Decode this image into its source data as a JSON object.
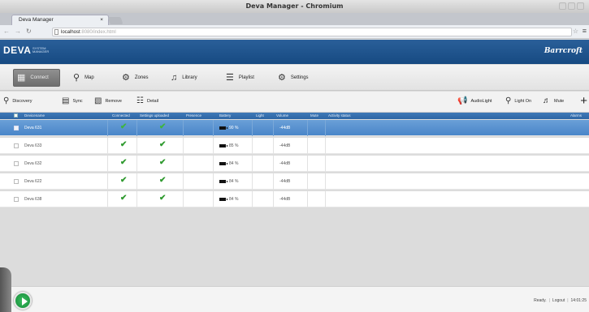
{
  "window": {
    "title": "Deva Manager - Chromium"
  },
  "browser": {
    "tab_title": "Deva Manager",
    "tab_close": "×",
    "url_host": "localhost",
    "url_path": ":8080/index.html"
  },
  "app": {
    "logo": "DEVA",
    "logo_sub": "SYSTEM MANAGER",
    "brand": "Barrcroft"
  },
  "nav": {
    "tabs": [
      {
        "label": "Connect",
        "icon": "devices-icon"
      },
      {
        "label": "Map",
        "icon": "map-pin-icon"
      },
      {
        "label": "Zones",
        "icon": "gear-icon"
      },
      {
        "label": "Library",
        "icon": "music-icon"
      },
      {
        "label": "Playlist",
        "icon": "playlist-icon"
      },
      {
        "label": "Settings",
        "icon": "settings-icon"
      }
    ]
  },
  "actions": {
    "left": [
      {
        "label": "Discovery",
        "icon": "search-icon"
      },
      {
        "label": "Sync",
        "icon": "sync-icon"
      },
      {
        "label": "Remove",
        "icon": "trash-icon"
      },
      {
        "label": "Detail",
        "icon": "detail-icon"
      }
    ],
    "right": [
      {
        "label": "AudioLight",
        "icon": "megaphone-icon"
      },
      {
        "label": "Light On",
        "icon": "bulb-icon"
      },
      {
        "label": "Mute",
        "icon": "speaker-icon"
      }
    ],
    "add": "+"
  },
  "table": {
    "columns": [
      "Devicename",
      "Connected",
      "Settings uploaded",
      "Presence",
      "Battery",
      "Light",
      "Volume",
      "Mute",
      "Activity status",
      "Alarms"
    ],
    "rows": [
      {
        "name": "Deva 631",
        "battery": "90 %",
        "volume": "-44dB",
        "selected": true
      },
      {
        "name": "Deva 633",
        "battery": "85 %",
        "volume": "-44dB",
        "selected": false
      },
      {
        "name": "Deva 632",
        "battery": "84 %",
        "volume": "-44dB",
        "selected": false
      },
      {
        "name": "Deva 622",
        "battery": "84 %",
        "volume": "-44dB",
        "selected": false
      },
      {
        "name": "Deva 638",
        "battery": "84 %",
        "volume": "-44dB",
        "selected": false
      }
    ]
  },
  "status": {
    "ready": "Ready.",
    "logout": "Logout",
    "time": "14:01:25"
  },
  "colors": {
    "header_blue": "#1f5590",
    "selected_row": "#5a93d0",
    "check_green": "#2f9a2f"
  }
}
